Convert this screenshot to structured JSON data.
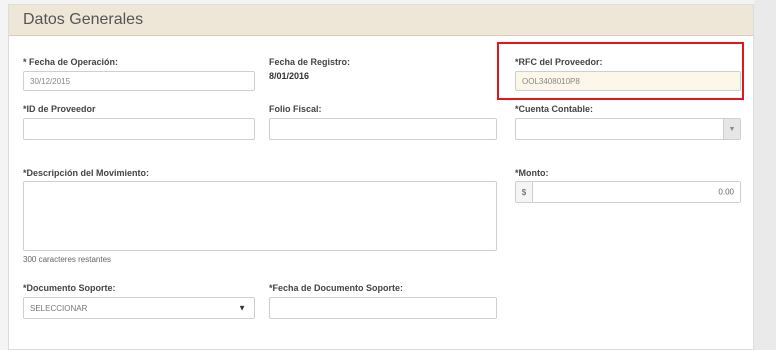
{
  "panel": {
    "title": "Datos Generales"
  },
  "fields": {
    "fecha_operacion": {
      "label": "* Fecha de Operación:",
      "value": "30/12/2015"
    },
    "fecha_registro": {
      "label": "Fecha de Registro:",
      "value": "8/01/2016"
    },
    "rfc_proveedor": {
      "label": "*RFC del Proveedor:",
      "value": "OOL3408010P8"
    },
    "id_proveedor": {
      "label": "*ID de Proveedor",
      "value": ""
    },
    "folio_fiscal": {
      "label": "Folio Fiscal:",
      "value": ""
    },
    "cuenta_contable": {
      "label": "*Cuenta Contable:",
      "value": ""
    },
    "descripcion": {
      "label": "*Descripción del Movimiento:",
      "value": "",
      "counter": "300 caracteres restantes"
    },
    "monto": {
      "label": "*Monto:",
      "currency": "$",
      "value": "0.00"
    },
    "documento_soporte": {
      "label": "*Documento Soporte:",
      "selected": "SELECCIONAR"
    },
    "fecha_documento": {
      "label": "*Fecha de Documento Soporte:",
      "value": ""
    }
  },
  "colors": {
    "highlight": "#e2161c",
    "header_bg": "#eee7d8"
  }
}
